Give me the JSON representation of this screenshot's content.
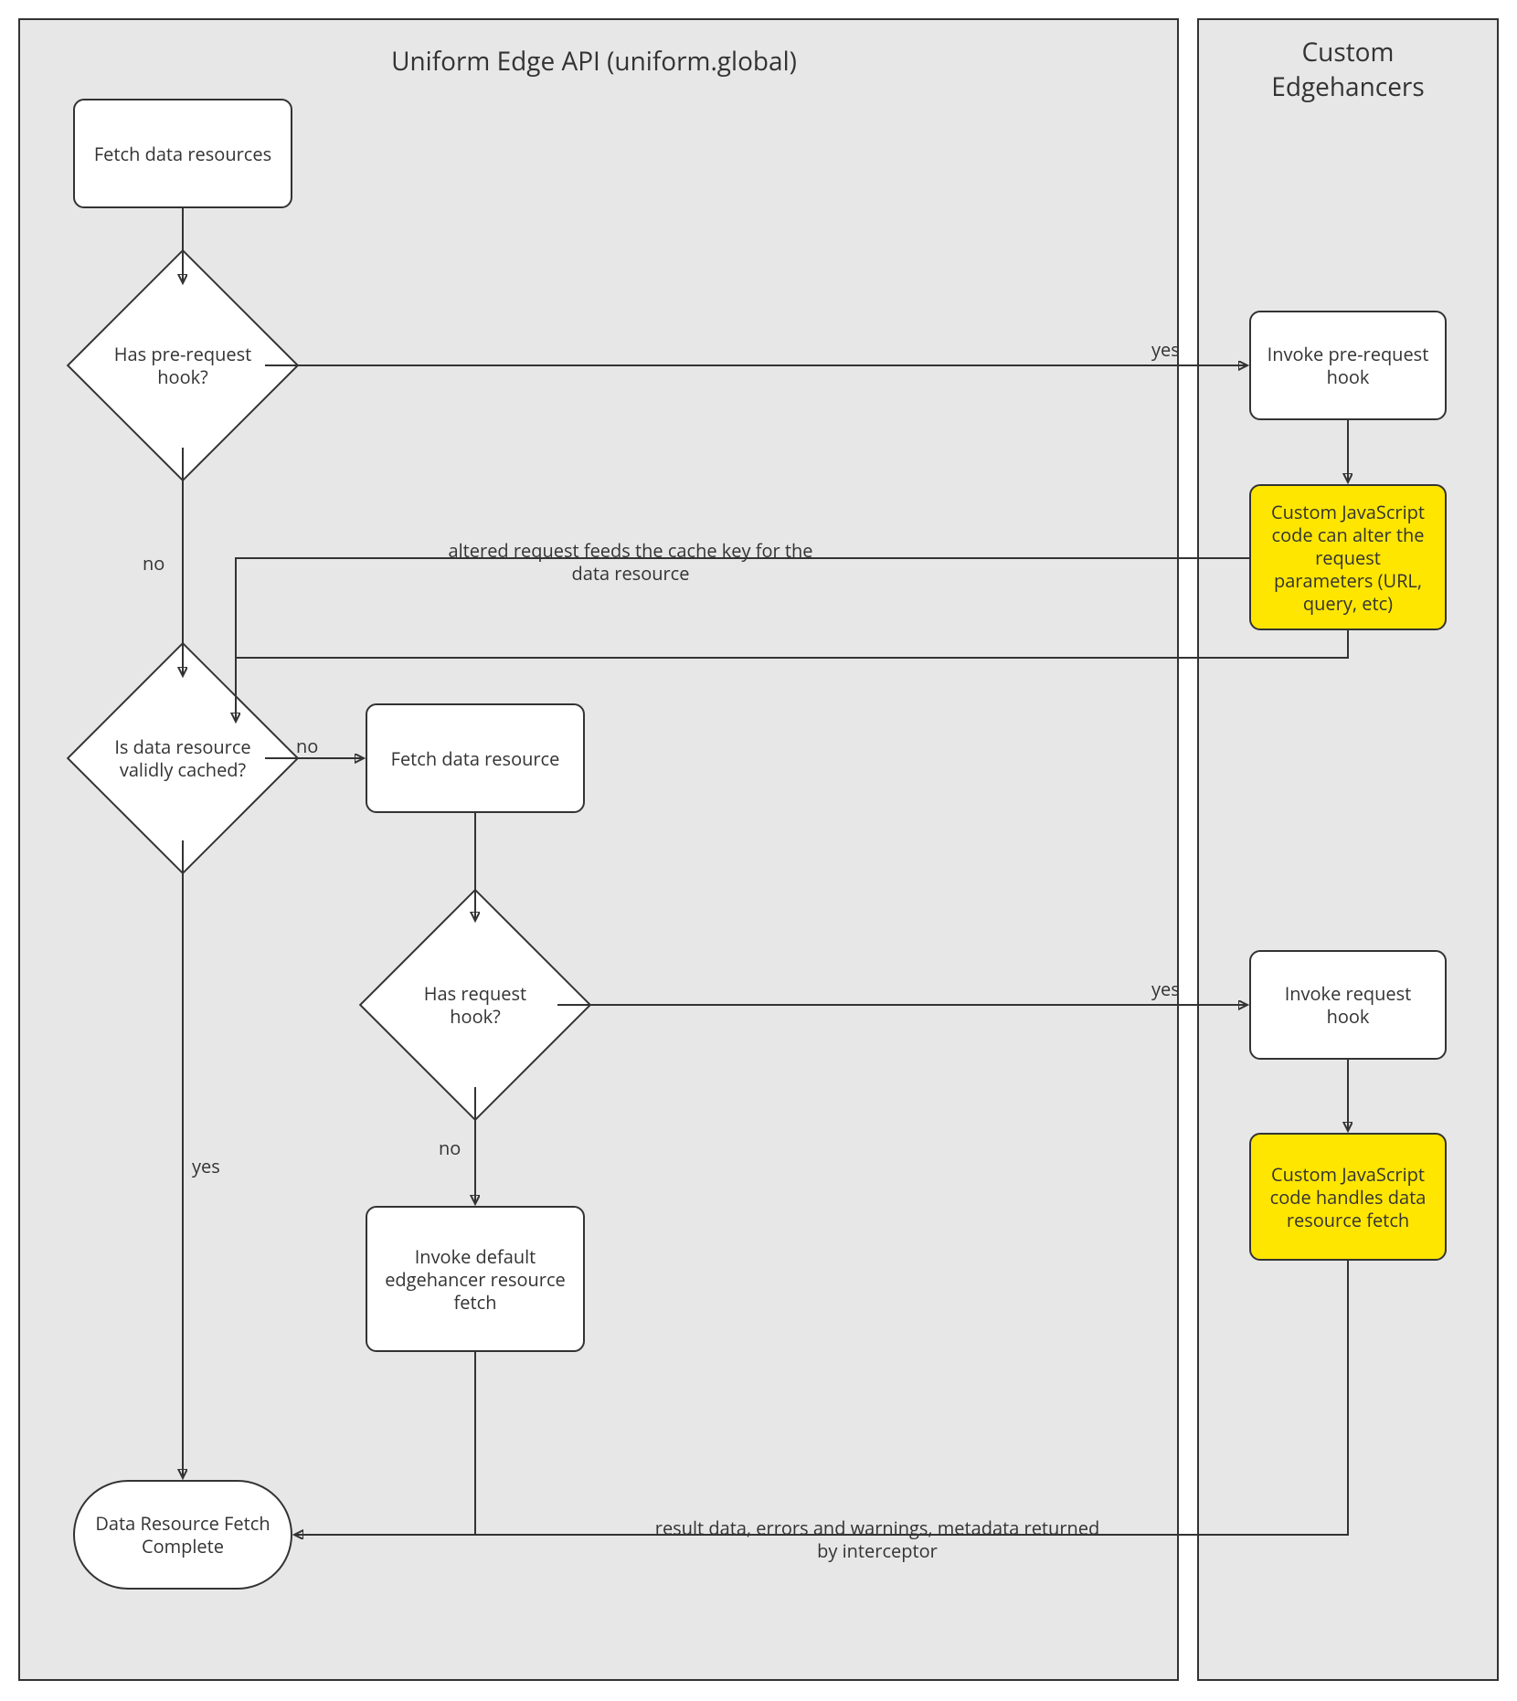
{
  "panels": {
    "left_title": "Uniform Edge API (uniform.global)",
    "right_title": "Custom Edgehancers"
  },
  "nodes": {
    "fetch_resources": "Fetch data resources",
    "has_pre_request_hook": "Has pre-request hook?",
    "invoke_pre_request_hook": "Invoke pre-request hook",
    "custom_alter_request": "Custom JavaScript code can alter the request parameters (URL, query, etc)",
    "is_cached": "Is data resource validly cached?",
    "fetch_data_resource": "Fetch data resource",
    "has_request_hook": "Has request hook?",
    "invoke_request_hook": "Invoke request hook",
    "custom_handle_fetch": "Custom JavaScript code handles data resource fetch",
    "invoke_default_fetch": "Invoke default edgehancer resource fetch",
    "complete": "Data Resource Fetch Complete"
  },
  "labels": {
    "yes": "yes",
    "no": "no",
    "altered_request": "altered request feeds the cache key for the data resource",
    "result_data": "result data, errors and warnings, metadata returned by interceptor"
  }
}
